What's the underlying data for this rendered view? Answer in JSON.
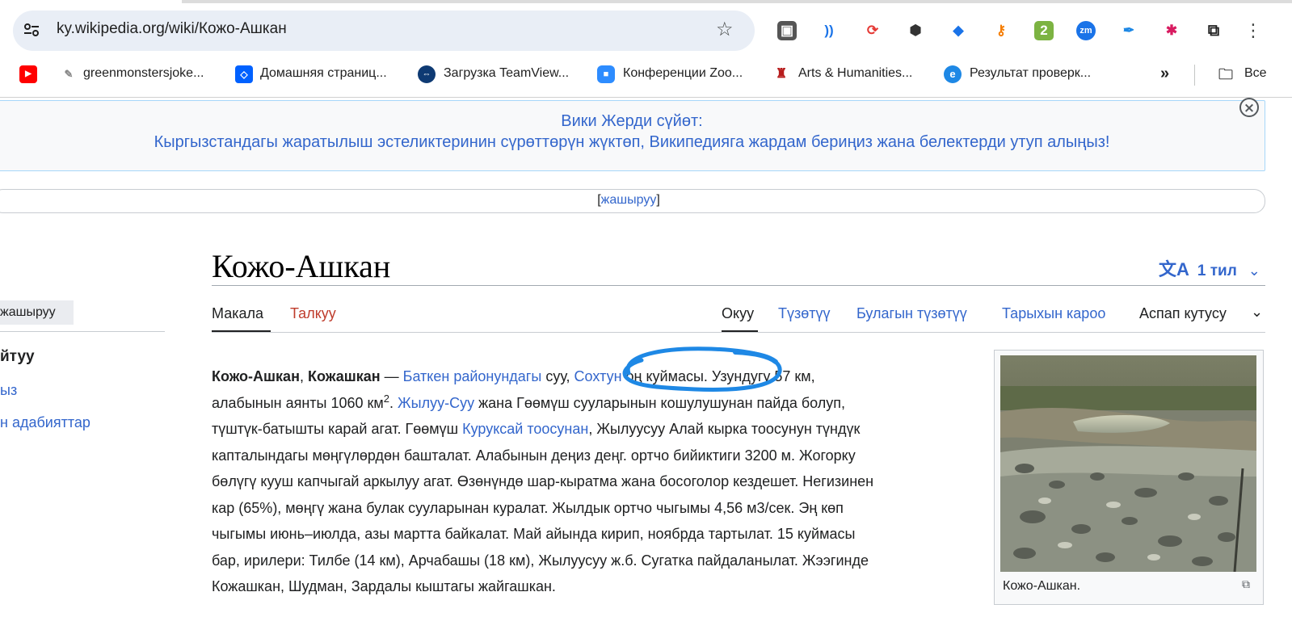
{
  "browser": {
    "url": "ky.wikipedia.org/wiki/Кожо-Ашкан",
    "extensions": [
      "ext-1",
      "ext-2",
      "ext-3",
      "ext-4",
      "ext-5",
      "ext-6",
      "ext-7",
      "ext-8",
      "ext-9",
      "ext-10"
    ],
    "ext_badge_2": "2",
    "ext_badge_zm": "zm",
    "bookmarks": [
      {
        "label": ""
      },
      {
        "label": "greenmonstersjoke..."
      },
      {
        "label": "Домашняя страниц..."
      },
      {
        "label": "Загрузка TeamView..."
      },
      {
        "label": "Конференции Zoo..."
      },
      {
        "label": "Arts & Humanities..."
      },
      {
        "label": "Результат проверк..."
      }
    ],
    "bookmarks_more": "»",
    "bookmarks_folder": "Все"
  },
  "sitenotice": {
    "line1": "Вики Жерди сүйөт:",
    "line2": "Кыргызстандагы жаратылыш эстеликтеринин сүрөттөрүн жүктөп, Википедияга жардам бериңиз жана белектерди утуп алыңыз!",
    "hide_link": "жашыруу",
    "bracket_open": "[",
    "bracket_close": "]"
  },
  "sidebar": {
    "hide_button": "жашыруу",
    "toc_title": "йтуу",
    "items": [
      {
        "label": "ыз"
      },
      {
        "label": "н адабияттар"
      }
    ]
  },
  "article": {
    "title": "Кожо-Ашкан",
    "languages": "1 тил",
    "tabs_left": [
      {
        "label": "Макала"
      },
      {
        "label": "Талкуу"
      }
    ],
    "tabs_right": [
      {
        "label": "Окуу"
      },
      {
        "label": "Түзөтүү"
      },
      {
        "label": "Булагын түзөтүү"
      },
      {
        "label": "Тарыхын кароо"
      },
      {
        "label": "Аспап кутусу"
      }
    ],
    "para": {
      "b1": "Кожо-Ашкан",
      "t1": ", ",
      "b2": "Кожашкан",
      "t2": " — ",
      "a1": "Баткен районундагы",
      "t3": " суу, ",
      "a2": "Сохтун",
      "t4": " оң куймасы. Узундугу 57 км,",
      "t5": "алабынын аянты 1060 км",
      "sup": "2",
      "t6": ". ",
      "a3": "Жылуу-Суу",
      "t7": " жана Гөөмүш сууларынын кошулушунан пайда болуп,",
      "t8": "түштүк-батышты карай агат. Гөөмүш ",
      "a4": "Куруксай тоосунан",
      "t9": ", Жылуусуу Алай кырка тоосунун түндүк",
      "l4": "капталындагы мөңгүлөрдөн башталат. Алабынын деңиз деңг. ортчо бийиктиги 3200 м. Жогорку",
      "l5": "бөлүгү кууш капчыгай аркылуу агат. Өзөнүндө шар-кыратма жана босоголор кездешет. Негизинен",
      "l6": "кар (65%), мөңгү жана булак сууларынан куралат. Жылдык ортчо чыгымы 4,56 м3/сек. Эң көп",
      "l7": "чыгымы июнь–июлда, азы мартта байкалат. Май айында кирип, ноябрда тартылат. 15 куймасы",
      "l8": "бар, ирилери: Тилбе (14 км), Арчабашы (18 км), Жылуусуу ж.б. Сугатка пайдаланылат. Жээгинде",
      "l9": "Кожашкан, Шудман, Зардалы кыштагы жайгашкан."
    },
    "thumb_caption": "Кожо-Ашкан."
  },
  "colors": {
    "link": "#3366cc",
    "redlink": "#bf3c2c",
    "annotation": "#1e88e5"
  }
}
